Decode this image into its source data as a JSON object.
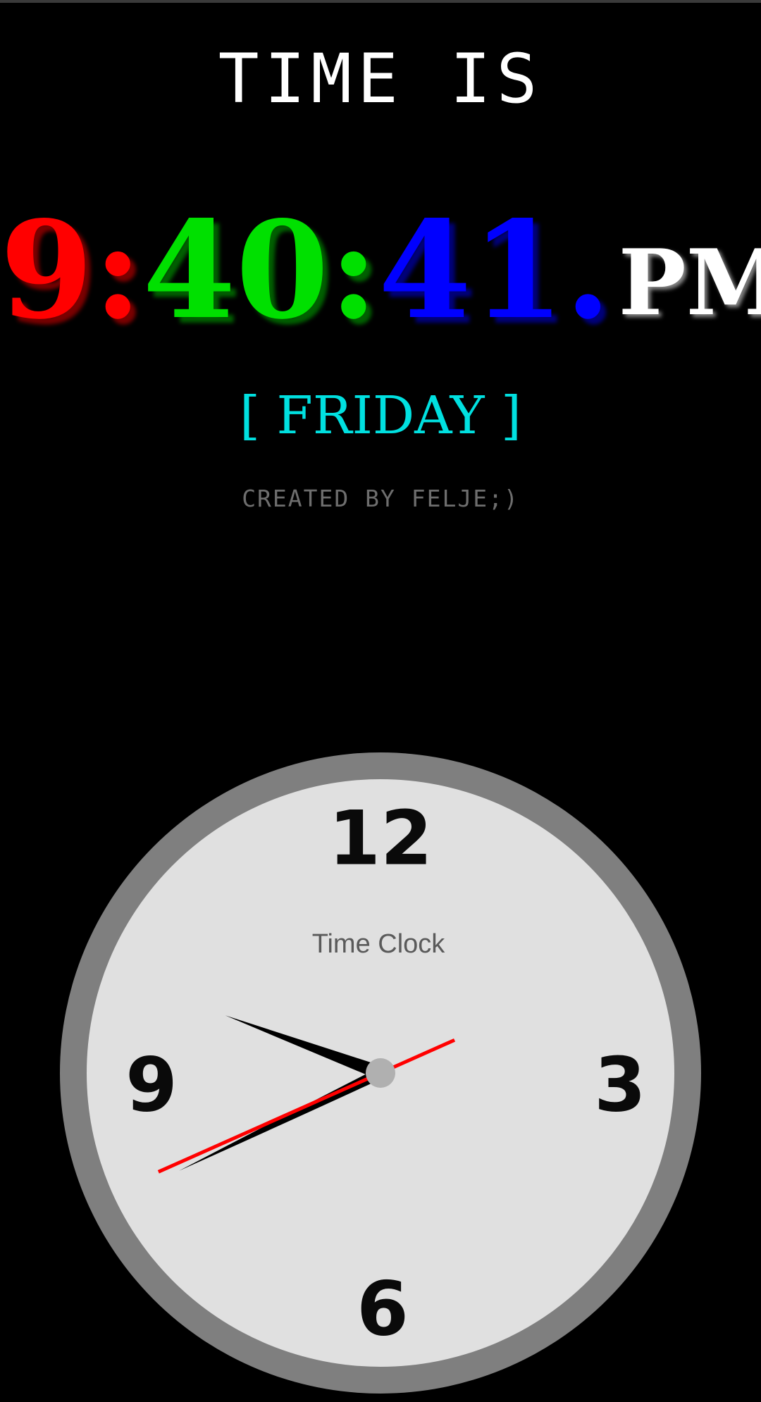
{
  "header": {
    "title": "TIME IS"
  },
  "digital_clock": {
    "hours": "9:",
    "minutes": "40:",
    "seconds": "41.",
    "ampm": "PM",
    "colors": {
      "hours": "#ff0000",
      "minutes": "#00e000",
      "seconds": "#0000ff",
      "ampm": "#ffffff"
    }
  },
  "day": {
    "text": "[ FRIDAY ]",
    "color": "#00e0e0"
  },
  "credit": {
    "text": "CREATED BY FELJE;)"
  },
  "analog_clock": {
    "label": "Time Clock",
    "numbers": {
      "twelve": "12",
      "three": "3",
      "six": "6",
      "nine": "9"
    },
    "time": {
      "hour": 9,
      "minute": 40,
      "second": 41
    },
    "colors": {
      "rim": "#7f7f7f",
      "face": "#e0e0e0",
      "hands": "#000000",
      "second_hand": "#ff0000",
      "center": "#b0b0b0"
    }
  }
}
